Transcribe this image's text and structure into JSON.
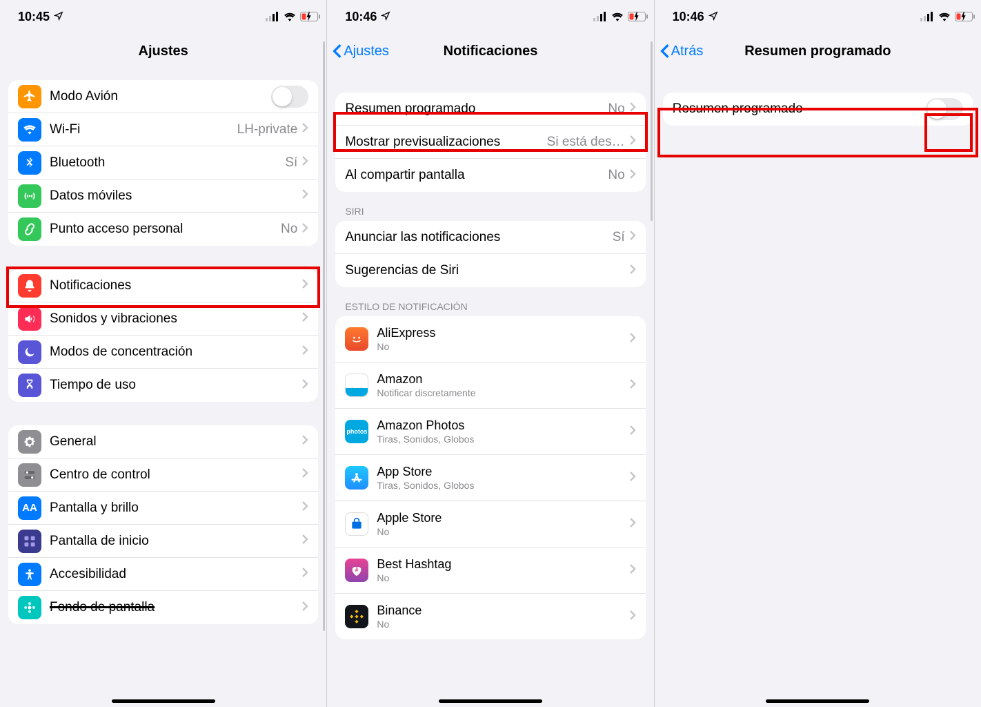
{
  "status": {
    "time1": "10:45",
    "time2": "10:46",
    "time3": "10:46"
  },
  "screen1": {
    "title": "Ajustes",
    "group1": [
      {
        "label": "Modo Avión",
        "value": "",
        "icon": "airplane",
        "bg": "#ff9500",
        "toggle": true
      },
      {
        "label": "Wi-Fi",
        "value": "LH-private",
        "icon": "wifi",
        "bg": "#007aff"
      },
      {
        "label": "Bluetooth",
        "value": "Sí",
        "icon": "bluetooth",
        "bg": "#007aff"
      },
      {
        "label": "Datos móviles",
        "value": "",
        "icon": "antenna",
        "bg": "#34c759"
      },
      {
        "label": "Punto acceso personal",
        "value": "No",
        "icon": "link",
        "bg": "#34c759"
      }
    ],
    "group2": [
      {
        "label": "Notificaciones",
        "icon": "bell",
        "bg": "#ff3b30",
        "hl": true
      },
      {
        "label": "Sonidos y vibraciones",
        "icon": "speaker",
        "bg": "#ff3b30"
      },
      {
        "label": "Modos de concentración",
        "icon": "moon",
        "bg": "#5856d6"
      },
      {
        "label": "Tiempo de uso",
        "icon": "hourglass",
        "bg": "#5856d6"
      }
    ],
    "group3": [
      {
        "label": "General",
        "icon": "gear",
        "bg": "#8e8e93"
      },
      {
        "label": "Centro de control",
        "icon": "switches",
        "bg": "#8e8e93"
      },
      {
        "label": "Pantalla y brillo",
        "icon": "aa",
        "bg": "#007aff"
      },
      {
        "label": "Pantalla de inicio",
        "icon": "grid",
        "bg": "#3f51b5"
      },
      {
        "label": "Accesibilidad",
        "icon": "person",
        "bg": "#007aff"
      },
      {
        "label": "Fondo de pantalla",
        "icon": "flower",
        "bg": "#00c7be"
      }
    ]
  },
  "screen2": {
    "back": "Ajustes",
    "title": "Notificaciones",
    "group1": [
      {
        "label": "Resumen programado",
        "value": "No",
        "hl": true
      },
      {
        "label": "Mostrar previsualizaciones",
        "value": "Si está des…"
      },
      {
        "label": "Al compartir pantalla",
        "value": "No"
      }
    ],
    "section_siri": "SIRI",
    "group2": [
      {
        "label": "Anunciar las notificaciones",
        "value": "Sí"
      },
      {
        "label": "Sugerencias de Siri",
        "value": ""
      }
    ],
    "section_style": "ESTILO DE NOTIFICACIÓN",
    "apps": [
      {
        "label": "AliExpress",
        "sub": "No",
        "bg": "#e8492b"
      },
      {
        "label": "Amazon",
        "sub": "Notificar discretamente",
        "bg": "#232f3e"
      },
      {
        "label": "Amazon Photos",
        "sub": "Tiras, Sonidos, Globos",
        "bg": "#00a8e1"
      },
      {
        "label": "App Store",
        "sub": "Tiras, Sonidos, Globos",
        "bg": "#1f8eff"
      },
      {
        "label": "Apple Store",
        "sub": "No",
        "bg": "#ffffff"
      },
      {
        "label": "Best Hashtag",
        "sub": "No",
        "bg": "#d63384"
      },
      {
        "label": "Binance",
        "sub": "No",
        "bg": "#12161c"
      }
    ]
  },
  "screen3": {
    "back": "Atrás",
    "title": "Resumen programado",
    "row": {
      "label": "Resumen programado"
    }
  }
}
